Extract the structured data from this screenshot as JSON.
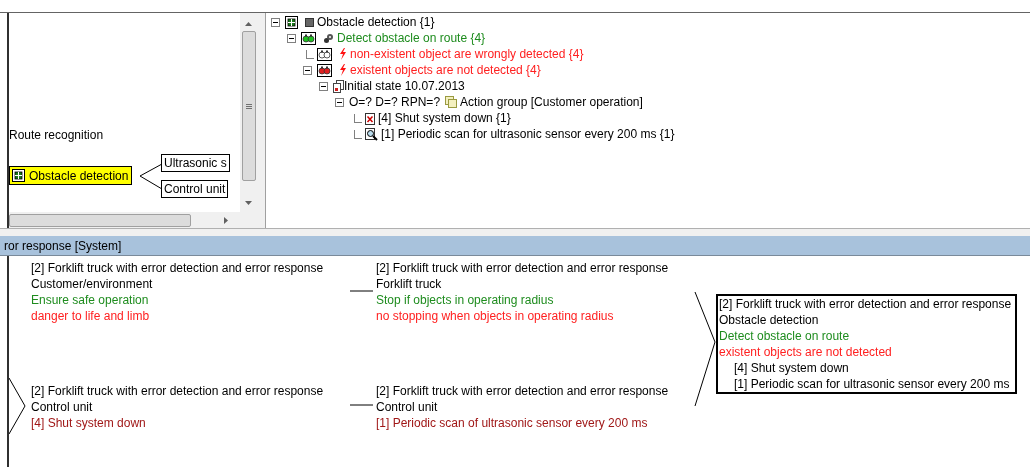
{
  "left_diagram": {
    "route_label": "Route recognition",
    "focus_node": {
      "text": "Obstacle detection",
      "selected": true
    },
    "child_nodes": [
      {
        "text": "Ultrasonic s"
      },
      {
        "text": "Control unit"
      }
    ]
  },
  "tree": [
    {
      "kind": "structure",
      "text": "Obstacle detection {1}",
      "expanded": true,
      "children": [
        {
          "kind": "function",
          "text": "Detect obstacle on route {4}",
          "expanded": true,
          "children": [
            {
              "kind": "failure_inactive",
              "text": "non-existent object are wrongly detected {4}"
            },
            {
              "kind": "failure",
              "text": "existent objects are not detected {4}",
              "expanded": true,
              "children": [
                {
                  "kind": "state",
                  "text": "Initial state 10.07.2013",
                  "expanded": true,
                  "children": [
                    {
                      "kind": "action_group",
                      "rating": "O=? D=? RPN=?",
                      "text": "Action group [Customer operation]",
                      "expanded": true,
                      "children": [
                        {
                          "kind": "avoidance_action",
                          "text": "[4] Shut system down {1}"
                        },
                        {
                          "kind": "detection_action",
                          "text": "[1] Periodic scan for ultrasonic sensor every 200 ms {1}"
                        }
                      ]
                    }
                  ]
                }
              ]
            }
          ]
        }
      ]
    }
  ],
  "net_header": "ror response [System]",
  "net_nodes": [
    {
      "selected": false,
      "lines": [
        {
          "kind": "title",
          "text": "[2] Forklift truck with error detection and error response"
        },
        {
          "kind": "title",
          "text": "Customer/environment"
        },
        {
          "kind": "function",
          "text": "Ensure safe operation"
        },
        {
          "kind": "failure",
          "text": "danger to life and limb"
        }
      ]
    },
    {
      "selected": false,
      "lines": [
        {
          "kind": "title",
          "text": "[2] Forklift truck with error detection and error response"
        },
        {
          "kind": "title",
          "text": "Forklift truck"
        },
        {
          "kind": "function",
          "text": "Stop if objects in operating radius"
        },
        {
          "kind": "failure",
          "text": "no stopping when objects in operating radius"
        }
      ]
    },
    {
      "selected": true,
      "lines": [
        {
          "kind": "title",
          "text": "[2] Forklift truck with error detection and error response"
        },
        {
          "kind": "title",
          "text": "Obstacle detection"
        },
        {
          "kind": "function",
          "text": "Detect obstacle on route"
        },
        {
          "kind": "failure",
          "text": "existent objects are not detected"
        },
        {
          "kind": "sub_action",
          "text": "[4] Shut system down"
        },
        {
          "kind": "sub_action",
          "text": "[1] Periodic scan for ultrasonic sensor every 200 ms"
        }
      ]
    },
    {
      "selected": false,
      "lines": [
        {
          "kind": "title",
          "text": "[2] Forklift truck with error detection and error response"
        },
        {
          "kind": "title",
          "text": "Control unit"
        },
        {
          "kind": "action",
          "text": "[4] Shut system down"
        }
      ]
    },
    {
      "selected": false,
      "lines": [
        {
          "kind": "title",
          "text": "[2] Forklift truck with error detection and error response"
        },
        {
          "kind": "title",
          "text": "Control unit"
        },
        {
          "kind": "action",
          "text": "[1] Periodic scan of ultrasonic sensor every 200 ms"
        }
      ]
    }
  ]
}
